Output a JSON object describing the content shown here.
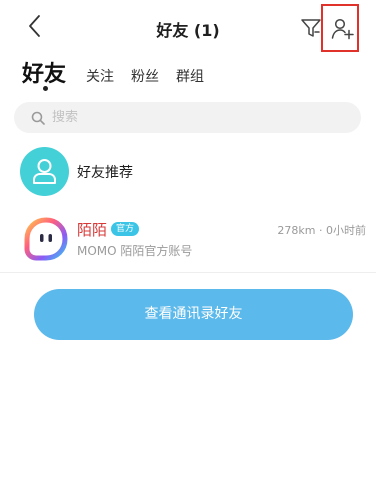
{
  "header": {
    "title": "好友 (1)"
  },
  "tabs": {
    "active": "好友",
    "follow": "关注",
    "fans": "粉丝",
    "groups": "群组"
  },
  "search": {
    "placeholder": "搜索",
    "value": ""
  },
  "recommend": {
    "label": "好友推荐"
  },
  "contacts": [
    {
      "name": "陌陌",
      "badge": "官方",
      "meta": "278km · 0小时前",
      "subtitle": "MOMO 陌陌官方账号"
    }
  ],
  "actions": {
    "contacts_button": "查看通讯录好友"
  },
  "colors": {
    "accent": "#5cb9eb",
    "highlight_box": "#e0312b",
    "recommend_avatar": "#43d0d6",
    "official_badge": "#3cc4e6",
    "contact_name": "#d63a38"
  },
  "icons": [
    "back-arrow-icon",
    "filter-icon",
    "add-friend-icon",
    "search-icon",
    "person-icon",
    "momo-logo-icon"
  ]
}
